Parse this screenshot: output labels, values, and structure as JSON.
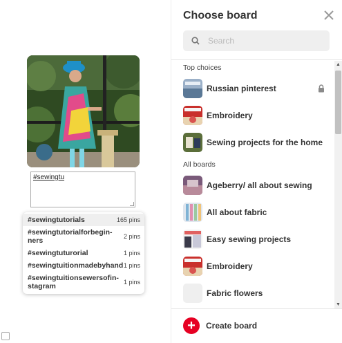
{
  "pin": {
    "description_value": "#sewingtu"
  },
  "suggestions": [
    {
      "tag": "#sewingtutorials",
      "count": "165 pins"
    },
    {
      "tag": "#sewingtutorialforbegin-ners",
      "count": "2 pins"
    },
    {
      "tag": "#sewingtuturorial",
      "count": "1 pins"
    },
    {
      "tag": "#sewingtuitionmadebyhand",
      "count": "1 pins"
    },
    {
      "tag": "#sewingtuitionsewersofin-stagram",
      "count": "1 pins"
    }
  ],
  "panel": {
    "title": "Choose board",
    "search_placeholder": "Search",
    "top_choices_label": "Top choices",
    "all_boards_label": "All boards",
    "create_label": "Create board"
  },
  "top_choices": [
    {
      "name": "Russian pinterest",
      "icon": "lock-icon"
    },
    {
      "name": "Embroidery"
    },
    {
      "name": "Sewing projects for the home"
    }
  ],
  "all_boards": [
    {
      "name": "Ageberry/ all about sewing"
    },
    {
      "name": "All about fabric"
    },
    {
      "name": "Easy sewing projects"
    },
    {
      "name": "Embroidery"
    },
    {
      "name": "Fabric flowers"
    }
  ],
  "colors": {
    "brand_red": "#e60023",
    "search_bg": "#efefef"
  }
}
